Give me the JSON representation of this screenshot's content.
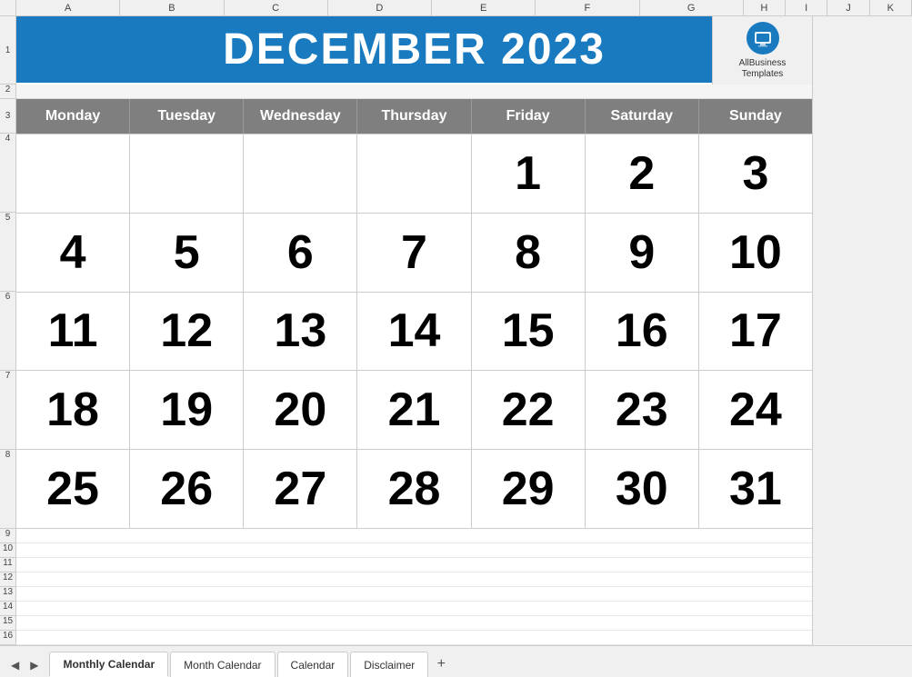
{
  "calendar": {
    "title": "DECEMBER 2023",
    "month": "DECEMBER",
    "year": "2023",
    "days_of_week": [
      "Monday",
      "Tuesday",
      "Wednesday",
      "Thursday",
      "Friday",
      "Saturday",
      "Sunday"
    ],
    "weeks": [
      [
        "",
        "",
        "",
        "",
        "1",
        "2",
        "3"
      ],
      [
        "4",
        "5",
        "6",
        "7",
        "8",
        "9",
        "10"
      ],
      [
        "11",
        "12",
        "13",
        "14",
        "15",
        "16",
        "17"
      ],
      [
        "18",
        "19",
        "20",
        "21",
        "22",
        "23",
        "24"
      ],
      [
        "25",
        "26",
        "27",
        "28",
        "29",
        "30",
        "31"
      ]
    ],
    "col_letters": [
      "A",
      "B",
      "C",
      "D",
      "E",
      "F",
      "G",
      "H",
      "I",
      "J",
      "K"
    ],
    "row_numbers": [
      "1",
      "2",
      "3",
      "4",
      "5",
      "6",
      "7",
      "8",
      "9",
      "10",
      "11",
      "12",
      "13",
      "14",
      "15",
      "16"
    ]
  },
  "brand": {
    "name": "AllBusiness",
    "name2": "Templates"
  },
  "tabs": [
    {
      "label": "Monthly Calendar",
      "active": true
    },
    {
      "label": "Month Calendar",
      "active": false
    },
    {
      "label": "Calendar",
      "active": false
    },
    {
      "label": "Disclaimer",
      "active": false
    }
  ],
  "nav": {
    "prev": "◀",
    "next": "▶",
    "add": "+"
  }
}
